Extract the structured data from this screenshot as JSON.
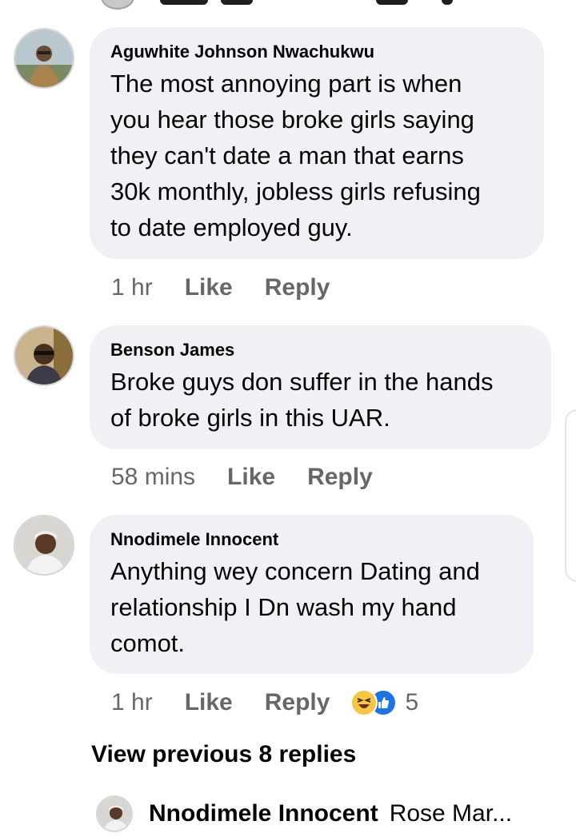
{
  "comments": [
    {
      "author": "Aguwhite Johnson Nwachukwu",
      "lines": [
        "The most annoying part is when",
        "you hear those broke girls saying",
        "they can't date a man that earns",
        "30k monthly, jobless girls refusing",
        "to date employed guy."
      ],
      "time": "1 hr",
      "like_label": "Like",
      "reply_label": "Reply"
    },
    {
      "author": "Benson James",
      "lines": [
        "Broke guys don suffer in the hands",
        "of broke girls in this UAR."
      ],
      "time": "58 mins",
      "like_label": "Like",
      "reply_label": "Reply"
    },
    {
      "author": "Nnodimele Innocent",
      "lines": [
        "Anything wey concern Dating and",
        "relationship I Dn wash my hand",
        "comot."
      ],
      "time": "1 hr",
      "like_label": "Like",
      "reply_label": "Reply",
      "reactions": {
        "icons": [
          "haha-icon",
          "like-icon"
        ],
        "count": "5"
      }
    }
  ],
  "view_previous": "View previous 8 replies",
  "latest_reply": {
    "author": "Nnodimele Innocent",
    "snippet": "Rose Mar..."
  }
}
